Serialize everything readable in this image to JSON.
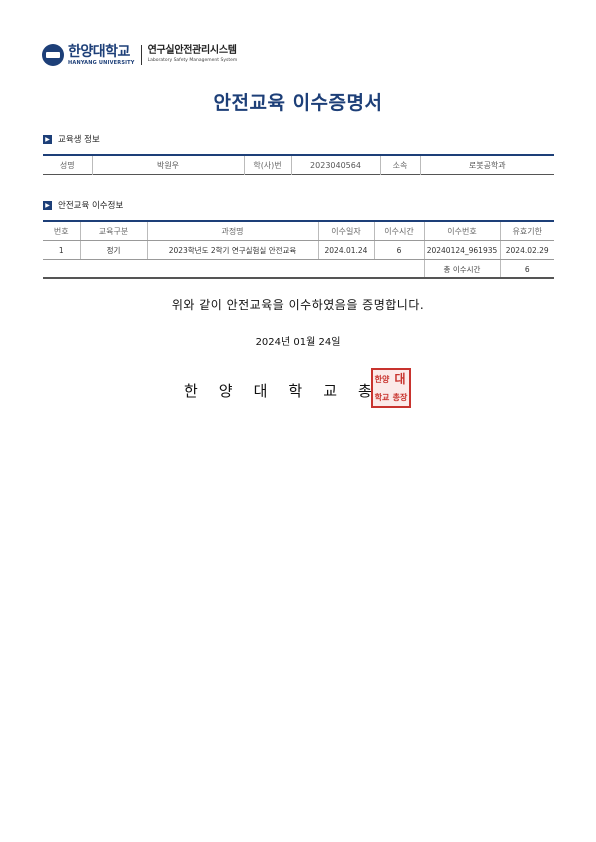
{
  "header": {
    "logo_ko": "한양대학교",
    "logo_en": "HANYANG UNIVERSITY",
    "system_ko": "연구실안전관리시스템",
    "system_en": "Laboratory Safety Management System"
  },
  "title": "안전교육 이수증명서",
  "student_section": {
    "heading": "교육생 정보",
    "name_label": "성명",
    "name_value": "박원우",
    "id_label": "학(사)번",
    "id_value": "2023040564",
    "dept_label": "소속",
    "dept_value": "로봇공학과"
  },
  "education_section": {
    "heading": "안전교육 이수정보",
    "columns": [
      "번호",
      "교육구분",
      "과정명",
      "이수일자",
      "이수시간",
      "이수번호",
      "유효기한"
    ],
    "rows": [
      {
        "no": "1",
        "type": "정기",
        "course": "2023학년도 2학기 연구실험실 안전교육",
        "date": "2024.01.24",
        "hours": "6",
        "cert_no": "20240124_961935",
        "expiry": "2024.02.29"
      }
    ],
    "total_label": "총 이수시간",
    "total_value": "6"
  },
  "statement": "위와 같이 안전교육을 이수하였음을 증명합니다.",
  "issue_date": "2024년 01월 24일",
  "issuer": "한양대학교총",
  "seal": {
    "chars": [
      "한양",
      "대",
      "학교",
      "총장"
    ],
    "color": "#c8332e"
  },
  "colors": {
    "accent": "#1d3f78"
  }
}
